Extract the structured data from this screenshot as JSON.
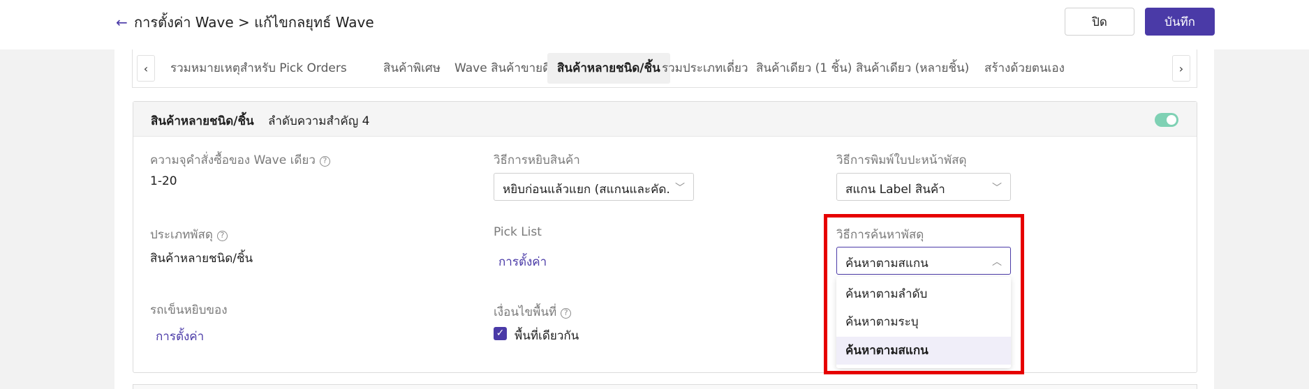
{
  "header": {
    "breadcrumb": "การตั้งค่า Wave > แก้ไขกลยุทธ์ Wave",
    "close_label": "ปิด",
    "save_label": "บันทึก"
  },
  "tabs": [
    {
      "label": "รวมหมายเหตุสำหรับ Pick Orders",
      "active": false
    },
    {
      "label": "สินค้าพิเศษ",
      "active": false
    },
    {
      "label": "Wave สินค้าขายดี",
      "active": false
    },
    {
      "label": "สินค้าหลายชนิด/ชิ้น",
      "active": true
    },
    {
      "label": "รวมประเภทเดี่ยว",
      "active": false
    },
    {
      "label": "สินค้าเดียว (1 ชิ้น)",
      "active": false
    },
    {
      "label": "สินค้าเดียว (หลายชิ้น)",
      "active": false
    },
    {
      "label": "สร้างด้วยตนเอง",
      "active": false
    }
  ],
  "card": {
    "title": "สินค้าหลายชนิด/ชิ้น",
    "priority": "ลำดับความสำคัญ 4",
    "enabled": true
  },
  "fields": {
    "wave_capacity": {
      "label": "ความจุคำสั่งซื้อของ Wave เดียว",
      "value": "1-20"
    },
    "pick_method": {
      "label": "วิธีการหยิบสินค้า",
      "value": "หยิบก่อนแล้วแยก (สแกนและคัด..."
    },
    "print_method": {
      "label": "วิธีการพิมพ์ใบปะหน้าพัสดุ",
      "value": "สแกน Label สินค้า"
    },
    "parcel_type": {
      "label": "ประเภทพัสดุ",
      "value": "สินค้าหลายชนิด/ชิ้น"
    },
    "pick_list": {
      "label": "Pick List",
      "link": "การตั้งค่า"
    },
    "search_method": {
      "label": "วิธีการค้นหาพัสดุ",
      "value": "ค้นหาตามสแกน"
    },
    "cart": {
      "label": "รถเข็นหยิบของ",
      "link": "การตั้งค่า"
    },
    "area_condition": {
      "label": "เงื่อนไขพื้นที่",
      "checkbox_label": "พื้นที่เดียวกัน",
      "checked": true
    }
  },
  "dropdown_options": [
    {
      "label": "ค้นหาตามลำดับ",
      "selected": false
    },
    {
      "label": "ค้นหาตามระบุ",
      "selected": false
    },
    {
      "label": "ค้นหาตามสแกน",
      "selected": true
    }
  ],
  "icons": {
    "back": "arrow-left-icon",
    "help": "question-circle-icon",
    "chevron": "chevron-down-icon",
    "check": "check-icon"
  },
  "colors": {
    "primary": "#4a3aa7",
    "toggle_on": "#7fd1b4",
    "highlight": "#e60000"
  }
}
